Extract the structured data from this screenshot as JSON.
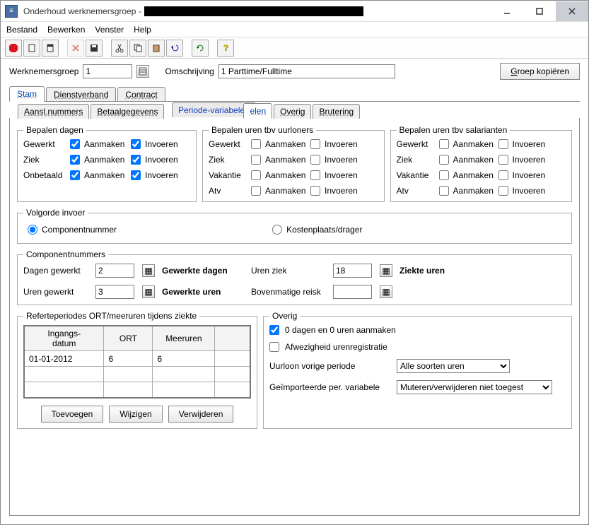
{
  "window": {
    "title": "Onderhoud werknemersgroep -"
  },
  "menu": {
    "bestand": "Bestand",
    "bewerken": "Bewerken",
    "venster": "Venster",
    "help": "Help"
  },
  "top": {
    "label_group": "Werknemersgroep",
    "value_group": "1",
    "label_desc": "Omschrijving",
    "value_desc": "1 Parttime/Fulltime",
    "btn_copy": "roep kopiëren",
    "btn_copy_u": "G"
  },
  "tabs_primary": {
    "stam": "Stam",
    "dienstverband": "Dienstverband",
    "contract": "Contract"
  },
  "tabs_secondary": {
    "aansl": "Aansl.nummers",
    "betaal": "Betaalgegevens",
    "periode": "Periode-variabelen",
    "elen": "elen",
    "overig": "Overig",
    "brutering": "Brutering"
  },
  "groups": {
    "dagen": "Bepalen dagen",
    "uurloners": "Bepalen uren tbv uurloners",
    "salarianten": "Bepalen uren tbv salarianten",
    "volgorde": "Volgorde invoer",
    "compnum": "Componentnummers",
    "referte": "Referteperiodes ORT/meeruren tijdens ziekte",
    "overig": "Overig"
  },
  "checks": {
    "gewerkt": "Gewerkt",
    "ziek": "Ziek",
    "onbetaald": "Onbetaald",
    "vakantie": "Vakantie",
    "atv": "Atv",
    "aanmaken": "Aanmaken",
    "invoeren": "Invoeren"
  },
  "volgorde": {
    "component": "Componentnummer",
    "kosten": "Kostenplaats/drager"
  },
  "compnum": {
    "dagen_gewerkt": "Dagen gewerkt",
    "dagen_gewerkt_val": "2",
    "dagen_gewerkt_bold": "Gewerkte dagen",
    "uren_gewerkt": "Uren gewerkt",
    "uren_gewerkt_val": "3",
    "uren_gewerkt_bold": "Gewerkte uren",
    "uren_ziek": "Uren ziek",
    "uren_ziek_val": "18",
    "uren_ziek_bold": "Ziekte uren",
    "bovenmatige": "Bovenmatige reisk",
    "bovenmatige_val": ""
  },
  "table": {
    "h1": "Ingangs-\ndatum",
    "h2": "ORT",
    "h3": "Meeruren",
    "r1c1": "01-01-2012",
    "r1c2": "6",
    "r1c3": "6",
    "btn_add": "Toevoegen",
    "btn_edit": "Wijzigen",
    "btn_del": "Verwijderen"
  },
  "overig": {
    "zero": "0 dagen en 0 uren aanmaken",
    "afw": "Afwezigheid urenregistratie",
    "uurloon": "Uurloon vorige periode",
    "uurloon_val": "Alle soorten uren",
    "geimp": "Geïmporteerde per. variabele",
    "geimp_val": "Muteren/verwijderen niet toegest"
  }
}
